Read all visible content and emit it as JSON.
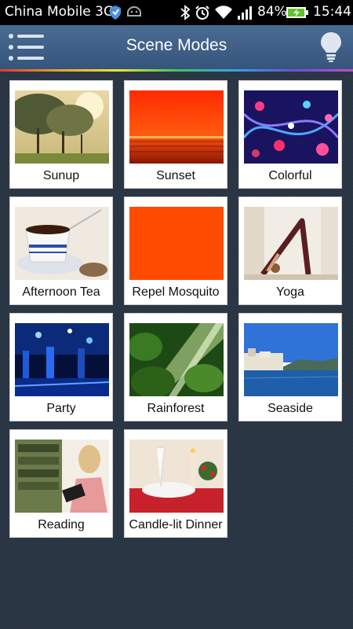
{
  "status_bar": {
    "carrier": "China Mobile 3G",
    "battery": "84%",
    "time": "15:44"
  },
  "title_bar": {
    "title": "Scene Modes"
  },
  "colors": {
    "title_bar": "#3f6088",
    "background": "#2c3746",
    "card": "#ffffff"
  },
  "scenes": [
    {
      "label": "Sunup"
    },
    {
      "label": "Sunset"
    },
    {
      "label": "Colorful"
    },
    {
      "label": "Afternoon Tea"
    },
    {
      "label": "Repel Mosquito"
    },
    {
      "label": "Yoga"
    },
    {
      "label": "Party"
    },
    {
      "label": "Rainforest"
    },
    {
      "label": "Seaside"
    },
    {
      "label": "Reading"
    },
    {
      "label": "Candle-lit Dinner"
    }
  ]
}
